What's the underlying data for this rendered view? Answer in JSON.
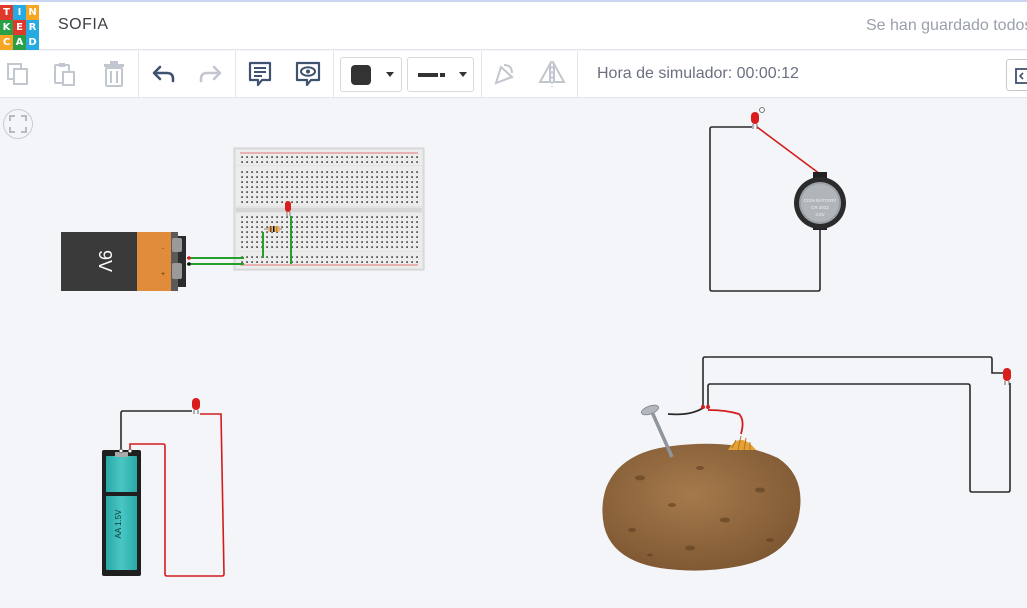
{
  "header": {
    "logo_letters": [
      "T",
      "I",
      "N",
      "K",
      "E",
      "R",
      "C",
      "A",
      "D"
    ],
    "logo_colors": [
      "#e0392b",
      "#27a9e1",
      "#f6a623",
      "#2b9f47",
      "#e0392b",
      "#27a9e1",
      "#f6a623",
      "#2b9f47",
      "#27a9e1"
    ],
    "project_title": "SOFIA",
    "save_status": "Se han guardado todos los cambios"
  },
  "toolbar": {
    "copy_icon": "copy-icon",
    "paste_icon": "paste-icon",
    "delete_icon": "trash-icon",
    "undo_icon": "undo-icon",
    "redo_icon": "redo-icon",
    "notes_icon": "notes-icon",
    "visibility_icon": "note-visibility-icon",
    "color_swatch": "#333333",
    "wire_type_icon": "wire-type-icon",
    "flip_icon": "flip-icon",
    "mirror_icon": "mirror-icon",
    "simulator_time": "Hora de simulador: 00:00:12"
  },
  "workspace": {
    "fit_view_icon": "fit-view-icon",
    "components": {
      "battery_9v_label": "9V",
      "battery_aa_label": "AA 1.5V",
      "coin_battery_label_1": "COIN BATTERY",
      "coin_battery_label_2": "CR 2032",
      "coin_battery_label_3": "3.0V"
    }
  }
}
